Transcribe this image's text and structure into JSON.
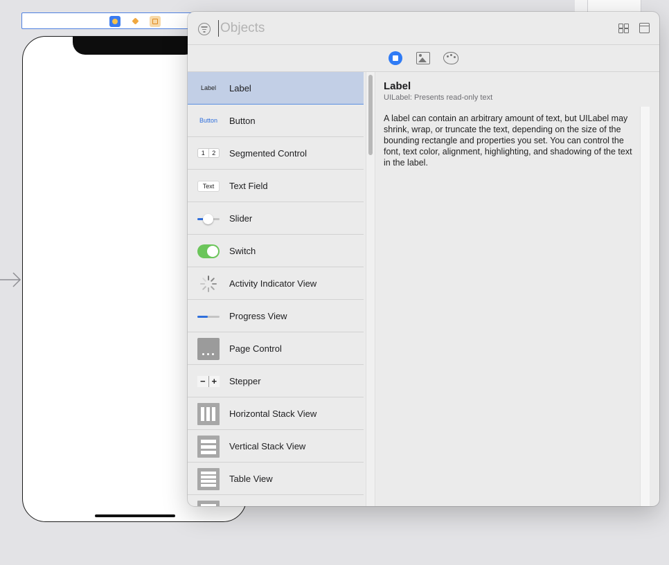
{
  "library": {
    "search_placeholder": "Objects",
    "tabs": [
      "objects-tab",
      "media-tab",
      "colors-tab"
    ],
    "accent_color": "#2f7bf5",
    "items": [
      {
        "label": "Label",
        "icon": "label-icon",
        "icon_text": "Label",
        "selected": true
      },
      {
        "label": "Button",
        "icon": "button-icon",
        "icon_text": "Button"
      },
      {
        "label": "Segmented Control",
        "icon": "segmented-control-icon",
        "seg_1": "1",
        "seg_2": "2"
      },
      {
        "label": "Text Field",
        "icon": "text-field-icon",
        "icon_text": "Text"
      },
      {
        "label": "Slider",
        "icon": "slider-icon"
      },
      {
        "label": "Switch",
        "icon": "switch-icon"
      },
      {
        "label": "Activity Indicator View",
        "icon": "activity-indicator-icon"
      },
      {
        "label": "Progress View",
        "icon": "progress-view-icon"
      },
      {
        "label": "Page Control",
        "icon": "page-control-icon"
      },
      {
        "label": "Stepper",
        "icon": "stepper-icon",
        "minus": "−",
        "plus": "+"
      },
      {
        "label": "Horizontal Stack View",
        "icon": "horizontal-stack-icon"
      },
      {
        "label": "Vertical Stack View",
        "icon": "vertical-stack-icon"
      },
      {
        "label": "Table View",
        "icon": "table-view-icon"
      },
      {
        "label": "",
        "icon": "collection-view-icon"
      }
    ],
    "detail": {
      "title": "Label",
      "subtitle": "UILabel: Presents read-only text",
      "body": "A label can contain an arbitrary amount of text, but UILabel may shrink, wrap, or truncate the text, depending on the size of the bounding rectangle and properties you set. You can control the font, text color, alignment, highlighting, and shadowing of the text in the label."
    }
  }
}
